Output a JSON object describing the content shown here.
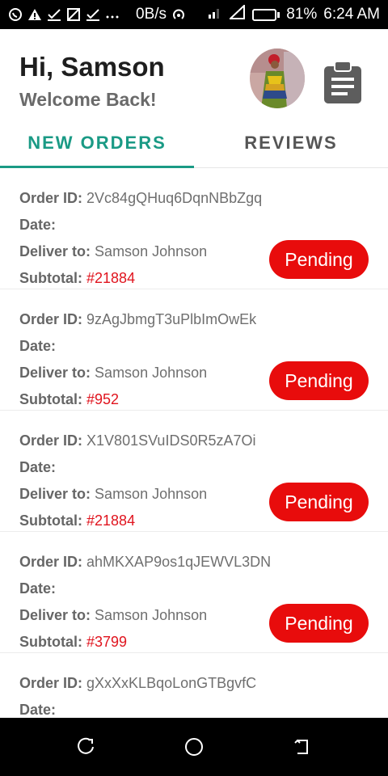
{
  "status_bar": {
    "net_speed": "0B/s",
    "battery": "81%",
    "battery_level": 0.81,
    "time": "6:24 AM",
    "icons": [
      "whatsapp-icon",
      "warning-icon",
      "check-icon",
      "screenshot-icon",
      "check-icon",
      "more-icon",
      "hotspot-icon",
      "signal-icon",
      "signal-icon",
      "battery-icon"
    ]
  },
  "header": {
    "greeting": "Hi, Samson",
    "subtitle": "Welcome Back!"
  },
  "tabs": [
    {
      "label": "NEW ORDERS",
      "active": true
    },
    {
      "label": "REVIEWS",
      "active": false
    }
  ],
  "labels": {
    "order_id": "Order ID:",
    "date": "Date:",
    "deliver_to": "Deliver to:",
    "subtotal": "Subtotal:"
  },
  "orders": [
    {
      "order_id": "2Vc84gQHuq6DqnNBbZgq",
      "date": "",
      "deliver_to": "Samson Johnson",
      "subtotal": "#21884",
      "status": "Pending"
    },
    {
      "order_id": "9zAgJbmgT3uPlbImOwEk",
      "date": "",
      "deliver_to": "Samson Johnson",
      "subtotal": "#952",
      "status": "Pending"
    },
    {
      "order_id": "X1V801SVuIDS0R5zA7Oi",
      "date": "",
      "deliver_to": "Samson Johnson",
      "subtotal": "#21884",
      "status": "Pending"
    },
    {
      "order_id": "ahMKXAP9os1qJEWVL3DN",
      "date": "",
      "deliver_to": "Samson Johnson",
      "subtotal": "#3799",
      "status": "Pending"
    },
    {
      "order_id": "gXxXxKLBqoLonGTBgvfC",
      "date": "",
      "deliver_to": "",
      "subtotal": "",
      "status": ""
    }
  ],
  "colors": {
    "accent": "#1a9a85",
    "pending": "#e80c0c",
    "subtotal": "#e0141e"
  }
}
